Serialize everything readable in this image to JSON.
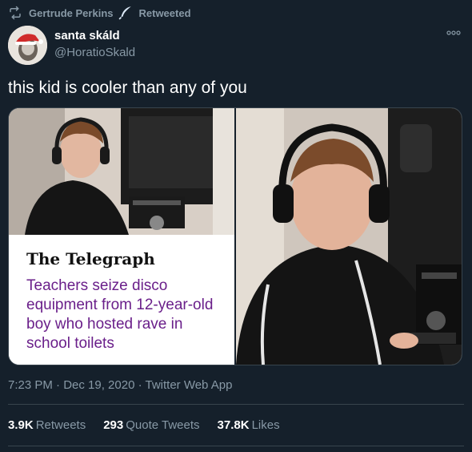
{
  "retweet": {
    "user": "Gertrude Perkins",
    "label": "Retweeted",
    "icon": "retweet-icon",
    "badge_icon": "feather-icon"
  },
  "author": {
    "display_name": "santa skáld",
    "handle": "@HoratioSkald"
  },
  "tweet": {
    "text": "this kid is cooler than any of you"
  },
  "media": {
    "masthead": "The Telegraph",
    "headline": "Teachers seize disco equipment from 12-year-old boy who hosted rave in school toilets",
    "headline_color": "#6a1f8a"
  },
  "meta": {
    "timestamp": "7:23 PM · Dec 19, 2020 · Twitter Web App"
  },
  "stats": {
    "retweets_count": "3.9K",
    "retweets_label": "Retweets",
    "quotes_count": "293",
    "quotes_label": "Quote Tweets",
    "likes_count": "37.8K",
    "likes_label": "Likes"
  },
  "colors": {
    "background": "#15202b",
    "secondary_text": "#8899a6",
    "border": "#38444d"
  }
}
